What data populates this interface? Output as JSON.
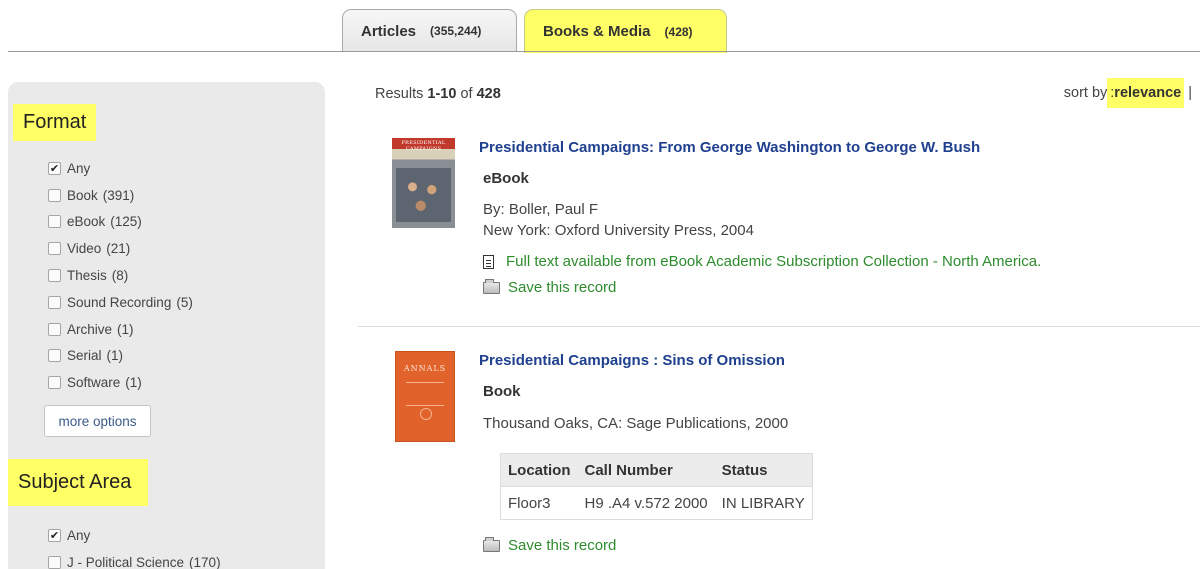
{
  "tabs": [
    {
      "label": "Articles",
      "count": "(355,244)",
      "active": false
    },
    {
      "label": "Books & Media",
      "count": "(428)",
      "active": true
    }
  ],
  "sidebar": {
    "format": {
      "heading": "Format",
      "items": [
        {
          "label": "Any",
          "count": "",
          "checked": true
        },
        {
          "label": "Book",
          "count": "(391)",
          "checked": false
        },
        {
          "label": "eBook",
          "count": "(125)",
          "checked": false
        },
        {
          "label": "Video",
          "count": "(21)",
          "checked": false
        },
        {
          "label": "Thesis",
          "count": "(8)",
          "checked": false
        },
        {
          "label": "Sound Recording",
          "count": "(5)",
          "checked": false
        },
        {
          "label": "Archive",
          "count": "(1)",
          "checked": false
        },
        {
          "label": "Serial",
          "count": "(1)",
          "checked": false
        },
        {
          "label": "Software",
          "count": "(1)",
          "checked": false
        }
      ],
      "more_label": "more options"
    },
    "subject": {
      "heading": "Subject Area",
      "items": [
        {
          "label": "Any",
          "count": "",
          "checked": true
        },
        {
          "label": "J - Political Science",
          "count": "(170)",
          "checked": false
        }
      ]
    }
  },
  "results": {
    "prefix": "Results ",
    "range": "1-10",
    "of": " of ",
    "total": "428"
  },
  "sort": {
    "label_prefix": "sort by",
    "label_suffix": ": ",
    "value": "relevance",
    "separator": "|"
  },
  "records": [
    {
      "title": "Presidential Campaigns: From George Washington to George W. Bush",
      "format": "eBook",
      "by": "By: Boller, Paul F",
      "publication": "New York: Oxford University Press, 2004",
      "fulltext": "Full text available from eBook Academic Subscription Collection - North America.",
      "save": "Save this record",
      "cover_text": "PRESIDENTIAL CAMPAIGNS"
    },
    {
      "title": "Presidential Campaigns : Sins of Omission",
      "format": "Book",
      "publication": "Thousand Oaks, CA: Sage Publications, 2000",
      "holdings": {
        "headers": [
          "Location",
          "Call Number",
          "Status"
        ],
        "rows": [
          [
            "Floor3",
            "H9 .A4 v.572 2000",
            "IN LIBRARY"
          ]
        ]
      },
      "save": "Save this record",
      "cover_text": "ANNALS"
    }
  ],
  "colors": {
    "highlight": "#ffff66",
    "title_link": "#1f3f8f",
    "action_green": "#2e8b2e",
    "sidebar_bg": "#eaeaea"
  }
}
